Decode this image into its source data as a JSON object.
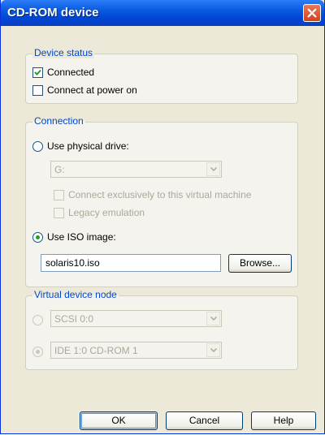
{
  "window": {
    "title": "CD-ROM device"
  },
  "device_status": {
    "title": "Device status",
    "connected_label": "Connected",
    "connected": true,
    "power_on_label": "Connect at power on",
    "power_on": false
  },
  "connection": {
    "title": "Connection",
    "physical_label": "Use physical drive:",
    "drive_value": "G:",
    "exclusive_label": "Connect exclusively to this virtual machine",
    "legacy_label": "Legacy emulation",
    "iso_label": "Use ISO image:",
    "iso_value": "solaris10.iso",
    "browse_label": "Browse..."
  },
  "virtual_node": {
    "title": "Virtual device node",
    "scsi_value": "SCSI 0:0",
    "ide_value": "IDE 1:0  CD-ROM 1"
  },
  "footer": {
    "ok_label": "OK",
    "cancel_label": "Cancel",
    "help_label": "Help"
  }
}
